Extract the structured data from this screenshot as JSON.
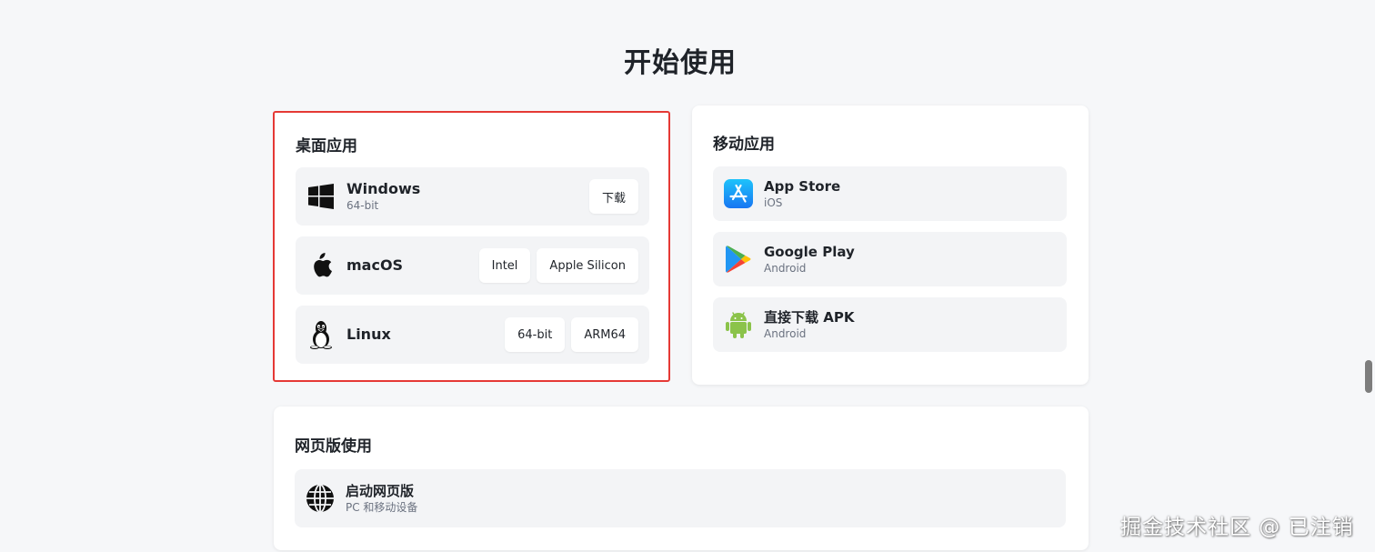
{
  "page_title": "开始使用",
  "desktop": {
    "title": "桌面应用",
    "items": [
      {
        "name": "Windows",
        "sub": "64-bit",
        "icon": "windows-icon",
        "buttons": [
          "下载"
        ]
      },
      {
        "name": "macOS",
        "icon": "apple-icon",
        "buttons": [
          "Intel",
          "Apple Silicon"
        ]
      },
      {
        "name": "Linux",
        "icon": "linux-tux-icon",
        "buttons": [
          "64-bit",
          "ARM64"
        ]
      }
    ]
  },
  "mobile": {
    "title": "移动应用",
    "items": [
      {
        "name": "App Store",
        "sub": "iOS",
        "icon": "app-store-icon"
      },
      {
        "name": "Google Play",
        "sub": "Android",
        "icon": "google-play-icon"
      },
      {
        "name": "直接下载 APK",
        "sub": "Android",
        "icon": "android-icon"
      }
    ]
  },
  "web": {
    "title": "网页版使用",
    "items": [
      {
        "name": "启动网页版",
        "sub": "PC 和移动设备",
        "icon": "globe-icon"
      }
    ]
  },
  "watermark": "掘金技术社区 @ 已注销",
  "colors": {
    "highlight_border": "#e53935",
    "app_store_blue": "#1a8cf5",
    "android_green": "#8bc34a"
  }
}
